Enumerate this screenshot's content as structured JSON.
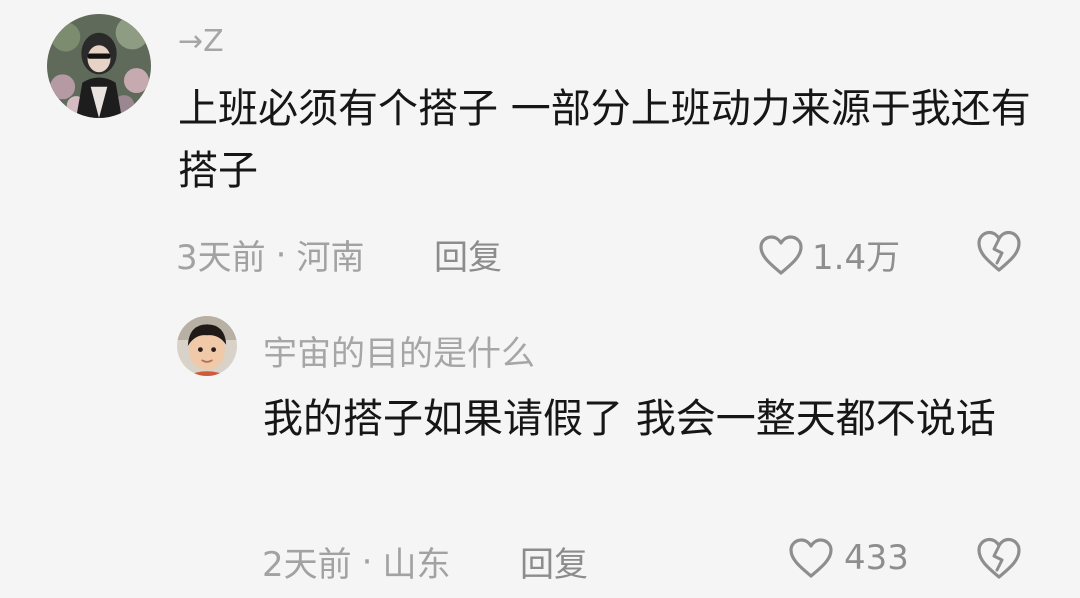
{
  "comments": [
    {
      "username": "→Z",
      "text": "上班必须有个搭子 一部分上班动力来源于我还有搭子",
      "time": "3天前",
      "location": "河南",
      "reply_label": "回复",
      "like_count": "1.4万",
      "avatar_icon": "avatar-woman-photo"
    },
    {
      "username": "宇宙的目的是什么",
      "text": "我的搭子如果请假了 我会一整天都不说话",
      "time": "2天前",
      "location": "山东",
      "reply_label": "回复",
      "like_count": "433",
      "avatar_icon": "avatar-child-photo"
    }
  ],
  "separator": "·",
  "icons": {
    "like": "heart-outline-icon",
    "dislike": "broken-heart-icon"
  },
  "colors": {
    "background": "#f5f5f5",
    "text_primary": "#161616",
    "text_secondary": "#a2a2a2",
    "icon": "#8e8e8e"
  }
}
